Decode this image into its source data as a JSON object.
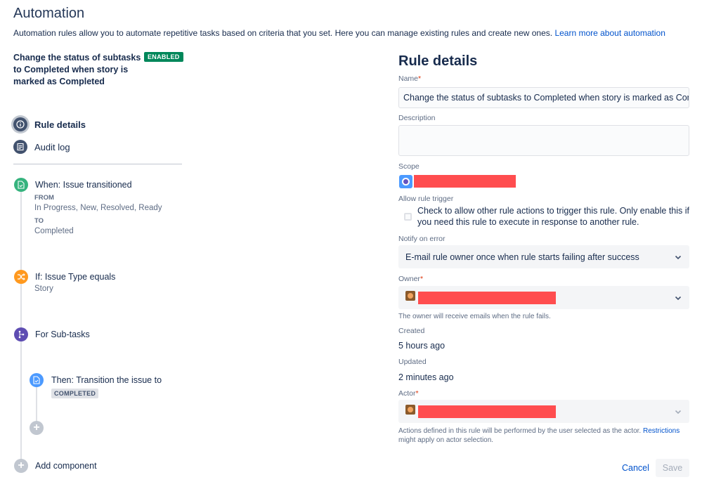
{
  "page": {
    "title": "Automation",
    "intro_text": "Automation rules allow you to automate repetitive tasks based on criteria that you set. Here you can manage existing rules and create new ones.",
    "intro_link": "Learn more about automation"
  },
  "rule": {
    "name": "Change the status of subtasks to Completed when story is marked as Completed",
    "status_badge": "ENABLED"
  },
  "nav": {
    "rule_details": "Rule details",
    "audit_log": "Audit log"
  },
  "steps": {
    "when": {
      "title": "When: Issue transitioned",
      "from_label": "FROM",
      "from_value": "In Progress, New, Resolved, Ready",
      "to_label": "TO",
      "to_value": "Completed"
    },
    "if": {
      "title": "If: Issue Type equals",
      "value": "Story"
    },
    "for": {
      "title": "For Sub-tasks"
    },
    "then": {
      "title": "Then: Transition the issue to",
      "lozenge": "COMPLETED"
    },
    "add_component": "Add component"
  },
  "details": {
    "title": "Rule details",
    "name_label": "Name",
    "name_value": "Change the status of subtasks to Completed when story is marked as Completed",
    "description_label": "Description",
    "description_value": "",
    "scope_label": "Scope",
    "allow_trigger_label": "Allow rule trigger",
    "allow_trigger_text": "Check to allow other rule actions to trigger this rule. Only enable this if you need this rule to execute in response to another rule.",
    "allow_trigger_checked": false,
    "notify_label": "Notify on error",
    "notify_value": "E-mail rule owner once when rule starts failing after success",
    "owner_label": "Owner",
    "owner_helper": "The owner will receive emails when the rule fails.",
    "created_label": "Created",
    "created_value": "5 hours ago",
    "updated_label": "Updated",
    "updated_value": "2 minutes ago",
    "actor_label": "Actor",
    "actor_helper_text": "Actions defined in this rule will be performed by the user selected as the actor.",
    "actor_helper_link": "Restrictions",
    "actor_helper_tail": "might apply on actor selection.",
    "required_mark": "*"
  },
  "buttons": {
    "cancel": "Cancel",
    "save": "Save"
  },
  "colors": {
    "enabled_badge": "#00875a",
    "when_icon": "#36b37e",
    "if_icon": "#ff991f",
    "for_icon": "#5e4db2",
    "then_icon": "#4c9aff",
    "link": "#0052cc",
    "redaction": "#ff4d4f"
  },
  "icons": {
    "rule_details": "info-icon",
    "audit_log": "list-icon",
    "when": "document-icon",
    "if": "shuffle-icon",
    "for": "branch-icon",
    "then": "document-icon",
    "add": "plus-icon",
    "dropdown": "chevron-down-icon"
  }
}
